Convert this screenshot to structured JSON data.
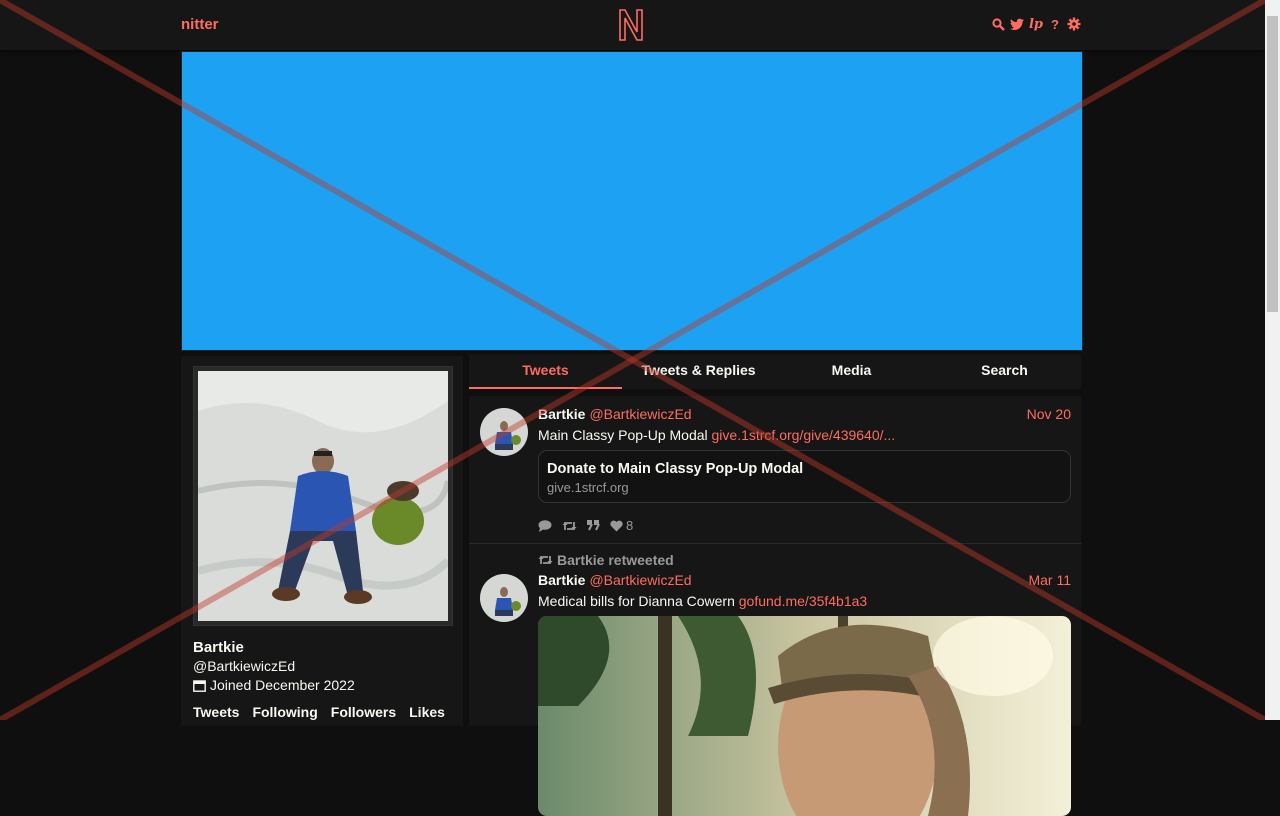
{
  "nav": {
    "logo_text": "nitter",
    "icons": [
      "search-icon",
      "twitter-bird-icon",
      "lp-icon",
      "help-icon",
      "gear-icon"
    ],
    "icon_glyphs": {
      "lp": "lp",
      "help": "?"
    }
  },
  "colors": {
    "accent": "#ff6c60",
    "banner": "#1da1f2",
    "bg": "#0f0f0f",
    "panel": "#161616"
  },
  "profile": {
    "name": "Bartkie",
    "handle": "@BartkiewiczEd",
    "joined": "Joined December 2022",
    "stats": [
      "Tweets",
      "Following",
      "Followers",
      "Likes"
    ]
  },
  "tabs": [
    {
      "label": "Tweets",
      "active": true
    },
    {
      "label": "Tweets & Replies",
      "active": false
    },
    {
      "label": "Media",
      "active": false
    },
    {
      "label": "Search",
      "active": false
    }
  ],
  "tweets": [
    {
      "name": "Bartkie",
      "handle": "@BartkiewiczEd",
      "date": "Nov 20",
      "text": "Main Classy Pop-Up Modal ",
      "link": "give.1strcf.org/give/439640/...",
      "card": {
        "title": "Donate to Main Classy Pop-Up Modal",
        "destination": "give.1strcf.org"
      },
      "stats": {
        "likes": "8"
      }
    },
    {
      "retweet_header": "Bartkie retweeted",
      "name": "Bartkie",
      "handle": "@BartkiewiczEd",
      "date": "Mar 11",
      "text": "Medical bills for Dianna Cowern ",
      "link": "gofund.me/35f4b1a3"
    }
  ]
}
